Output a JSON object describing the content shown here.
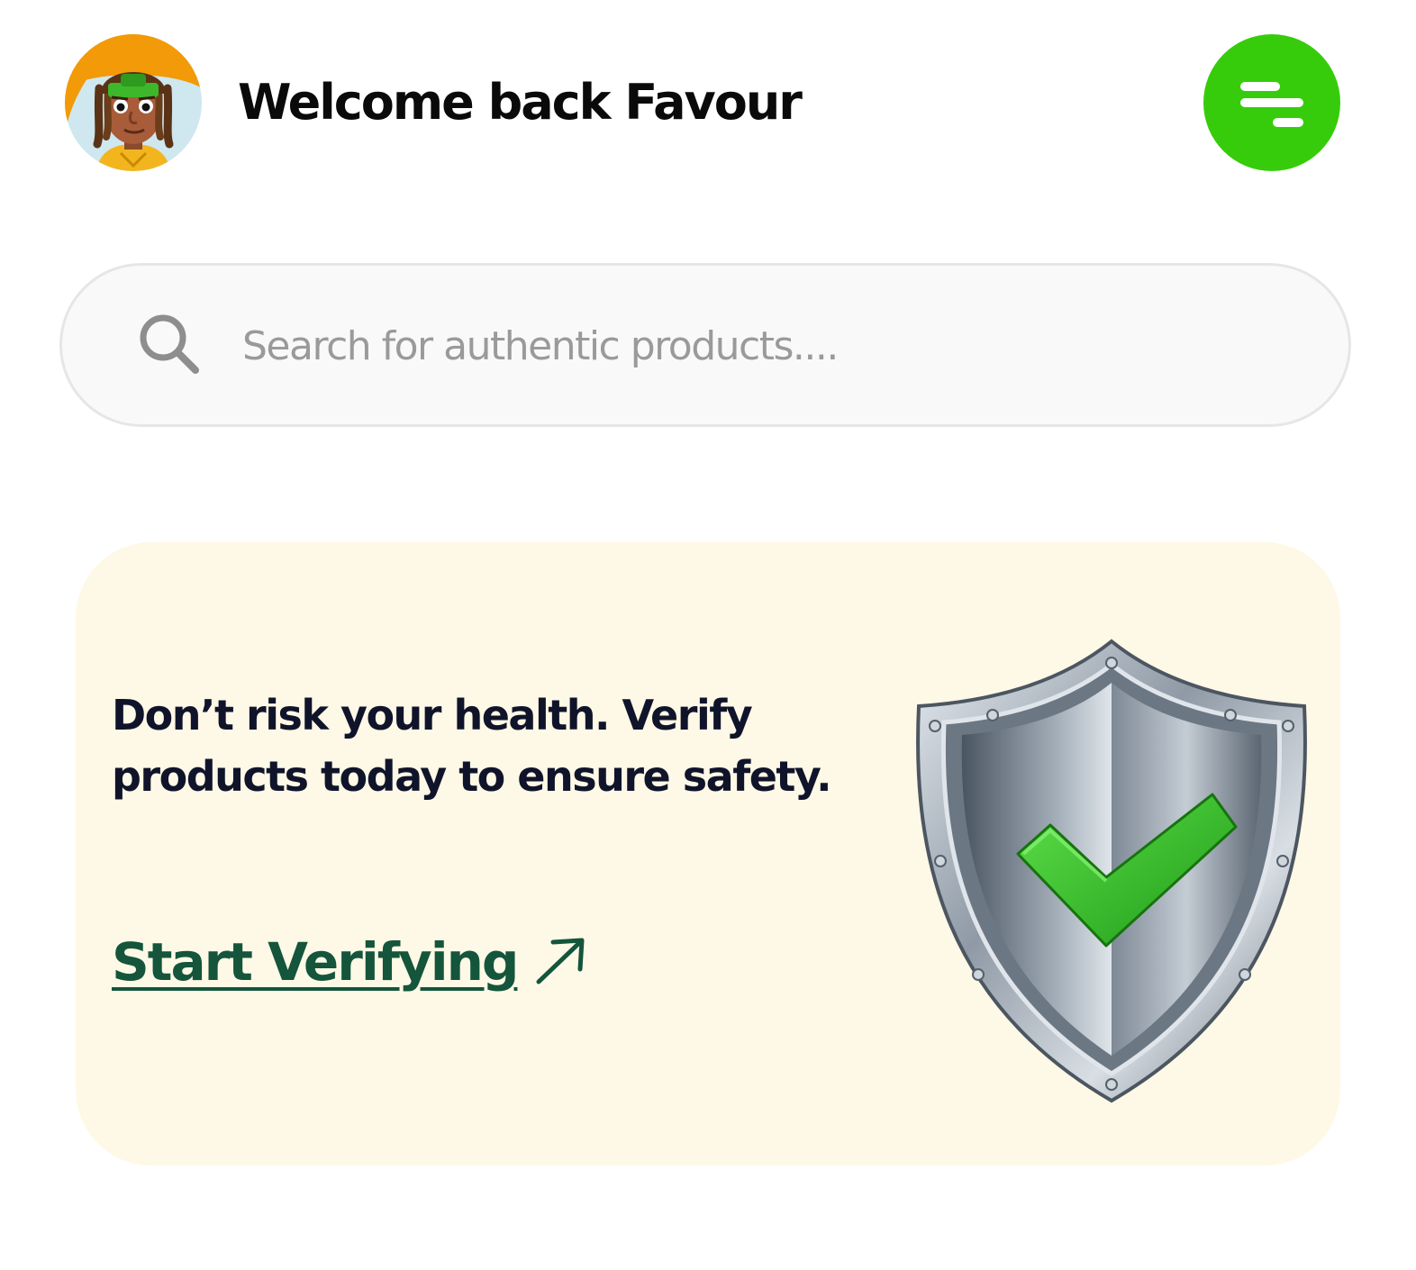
{
  "header": {
    "welcome_text": "Welcome back Favour",
    "avatar_icon": "user-avatar",
    "menu_icon": "filter-lines-icon",
    "accent_color": "#37cc0b"
  },
  "search": {
    "placeholder": "Search for authentic products....",
    "icon": "search-icon"
  },
  "banner": {
    "message": "Don’t risk your health. Verify products today to ensure safety.",
    "cta_label": "Start Verifying",
    "cta_icon": "arrow-up-right-icon",
    "illustration": "shield-check-icon",
    "background_color": "#fef8e6",
    "cta_color": "#14553c"
  }
}
